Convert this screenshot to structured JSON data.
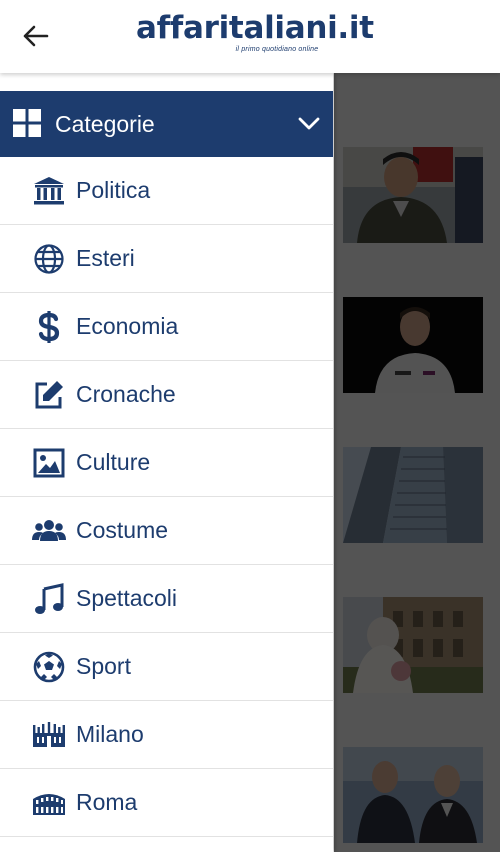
{
  "header": {
    "logo": "affaritaliani.it",
    "tagline": "il primo quotidiano online"
  },
  "drawer": {
    "section_title": "Categorie",
    "items": [
      {
        "label": "Politica",
        "icon": "bank-icon"
      },
      {
        "label": "Esteri",
        "icon": "globe-icon"
      },
      {
        "label": "Economia",
        "icon": "dollar-icon"
      },
      {
        "label": "Cronache",
        "icon": "edit-icon"
      },
      {
        "label": "Culture",
        "icon": "image-icon"
      },
      {
        "label": "Costume",
        "icon": "people-icon"
      },
      {
        "label": "Spettacoli",
        "icon": "music-icon"
      },
      {
        "label": "Sport",
        "icon": "soccer-ball-icon"
      },
      {
        "label": "Milano",
        "icon": "duomo-icon"
      },
      {
        "label": "Roma",
        "icon": "colosseum-icon"
      }
    ]
  },
  "colors": {
    "brand": "#1d3c6e",
    "divider": "#e2e2e2",
    "overlay": "#8d8d8d"
  }
}
